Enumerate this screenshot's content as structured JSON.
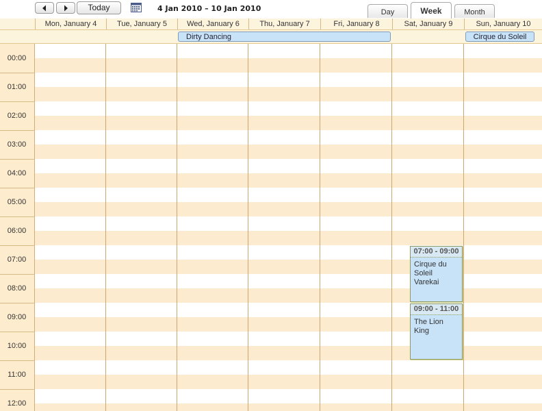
{
  "toolbar": {
    "prev_icon": "chevron-left-icon",
    "next_icon": "chevron-right-icon",
    "today_label": "Today",
    "calendar_icon": "calendar-icon",
    "date_range": "4 Jan 2010 – 10 Jan 2010"
  },
  "view_tabs": [
    {
      "label": "Day",
      "selected": false
    },
    {
      "label": "Week",
      "selected": true
    },
    {
      "label": "Month",
      "selected": false
    }
  ],
  "days": [
    "Mon, January 4",
    "Tue, January 5",
    "Wed, January 6",
    "Thu, January 7",
    "Fri, January 8",
    "Sat, January 9",
    "Sun, January 10"
  ],
  "all_day_events": [
    {
      "title": "Dirty Dancing",
      "start_day": "Wed, January 6",
      "end_day": "Fri, January 8"
    },
    {
      "title": "Cirque du Soleil",
      "start_day": "Sun, January 10",
      "end_day": "Sun, January 10"
    }
  ],
  "hours": [
    "00:00",
    "01:00",
    "02:00",
    "03:00",
    "04:00",
    "05:00",
    "06:00",
    "07:00",
    "08:00",
    "09:00",
    "10:00",
    "11:00",
    "12:00"
  ],
  "events": [
    {
      "time": "07:00 - 09:00",
      "title": "Cirque du Soleil Varekai",
      "day": "Sat, January 9"
    },
    {
      "time": "09:00 - 11:00",
      "title": "The Lion King",
      "day": "Sat, January 9"
    }
  ],
  "colors": {
    "accent_event": "#c8e2f7",
    "stripe": "#fdebd0",
    "gutter": "#fdeccd",
    "header": "#fdf4de",
    "grid_line": "#caa672"
  }
}
